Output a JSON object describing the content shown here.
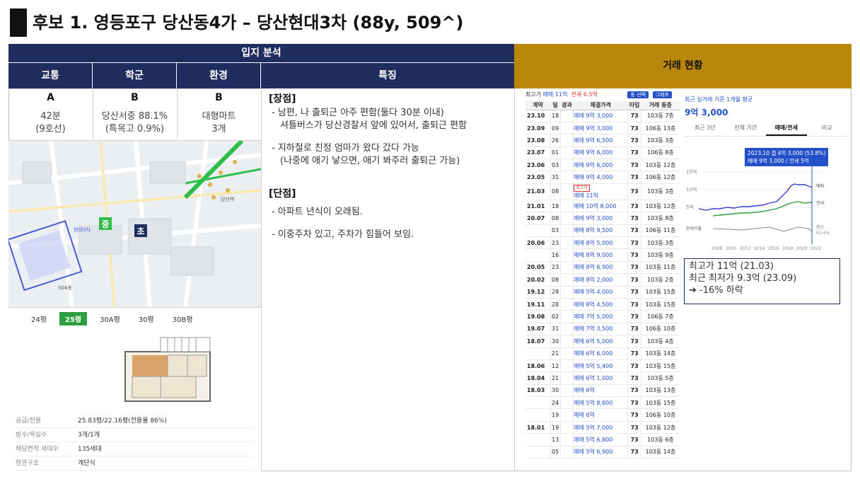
{
  "title": "후보 1. 영등포구 당산동4가 – 당산현대3차 (88y, 509^)",
  "analysis": {
    "header": "입지 분석",
    "columns": [
      "교통",
      "학군",
      "환경",
      "특징"
    ],
    "grades": [
      {
        "grade": "A",
        "desc_line1": "42분",
        "desc_line2": "(9호선)"
      },
      {
        "grade": "B",
        "desc_line1": "당산서중 88.1%",
        "desc_line2": "(특목고 0.9%)"
      },
      {
        "grade": "B",
        "desc_line1": "대형마트",
        "desc_line2": "3개"
      }
    ]
  },
  "map": {
    "labels": [
      "당산초",
      "중",
      "초",
      "현대3차",
      "당산역",
      "504동"
    ]
  },
  "floorplan": {
    "tabs": [
      "24평",
      "25평",
      "30A평",
      "30평",
      "30B평"
    ],
    "active_tab": "25평",
    "info": [
      {
        "k": "공급/전용",
        "v": "25.83평/22.16평(전용률 86%)"
      },
      {
        "k": "방수/욕실수",
        "v": "3개/1개"
      },
      {
        "k": "해당면적 세대수",
        "v": "135세대"
      },
      {
        "k": "현관구조",
        "v": "계단식"
      }
    ]
  },
  "features": {
    "pros_head": "[장점]",
    "pros": [
      "-  남편, 나 출퇴근 아주 편함(둘다 30분 이내)\n셔틀버스가 당산경찰서 앞에 있어서, 출퇴근 편함",
      "-  지하철로 친정 엄마가 왔다 갔다 가능\n(나중에 애기 낳으면, 애기 봐주러 출퇴근 가능)"
    ],
    "cons_head": "[단점]",
    "cons": [
      "-  아파트 년식이 오래됨.",
      "-  이중주차 있고, 주차가 힘들어 보임."
    ]
  },
  "deals": {
    "header": "거래 현황",
    "meta_high_label": "최고가",
    "meta_high_value": "매매 11억",
    "meta_rent_label": "전세 6.5억",
    "meta_btn1": "동 선택",
    "meta_btn2": "그래프",
    "table_headers": [
      "계약",
      "일",
      "경과",
      "체결가격",
      "타입",
      "거래 동층"
    ],
    "rows": [
      {
        "ym": "23.10",
        "d": "18",
        "price": "매매 9억 3,000",
        "type": "73",
        "floor": "103동 7층"
      },
      {
        "ym": "23.09",
        "d": "09",
        "price": "매매 9억 3,000",
        "type": "73",
        "floor": "106동 13층"
      },
      {
        "ym": "23.08",
        "d": "26",
        "price": "매매 9억 6,500",
        "type": "73",
        "floor": "103동 3층"
      },
      {
        "ym": "23.07",
        "d": "01",
        "price": "매매 9억 6,000",
        "type": "73",
        "floor": "106동 8층"
      },
      {
        "ym": "23.06",
        "d": "03",
        "price": "매매 9억 6,000",
        "type": "73",
        "floor": "103동 12층"
      },
      {
        "ym": "23.05",
        "d": "31",
        "price": "매매 9억 4,000",
        "type": "73",
        "floor": "106동 12층"
      },
      {
        "ym": "21.03",
        "d": "08",
        "price": "매매 11억",
        "type": "73",
        "floor": "103동 3층",
        "tag": "최고가"
      },
      {
        "ym": "21.01",
        "d": "18",
        "price": "매매 10억 8,000",
        "type": "73",
        "floor": "103동 12층"
      },
      {
        "ym": "20.07",
        "d": "08",
        "price": "매매 9억 3,000",
        "type": "73",
        "floor": "103동 8층"
      },
      {
        "ym": "",
        "d": "03",
        "price": "매매 8억 9,500",
        "type": "73",
        "floor": "106동 11층"
      },
      {
        "ym": "20.06",
        "d": "23",
        "price": "매매 8억 5,000",
        "type": "73",
        "floor": "103동 3층"
      },
      {
        "ym": "",
        "d": "16",
        "price": "매매 8억 9,000",
        "type": "73",
        "floor": "103동 9층"
      },
      {
        "ym": "20.05",
        "d": "23",
        "price": "매매 8억 6,900",
        "type": "73",
        "floor": "103동 11층"
      },
      {
        "ym": "20.02",
        "d": "08",
        "price": "매매 8억 2,000",
        "type": "73",
        "floor": "103동 2층"
      },
      {
        "ym": "19.12",
        "d": "28",
        "price": "매매 5억 4,000",
        "type": "73",
        "floor": "103동 15층"
      },
      {
        "ym": "19.11",
        "d": "28",
        "price": "매매 8억 4,500",
        "type": "73",
        "floor": "103동 15층"
      },
      {
        "ym": "19.08",
        "d": "02",
        "price": "매매 7억 5,000",
        "type": "73",
        "floor": "106동 7층"
      },
      {
        "ym": "19.07",
        "d": "31",
        "price": "매매 7억 3,500",
        "type": "73",
        "floor": "106동 10층"
      },
      {
        "ym": "18.07",
        "d": "30",
        "price": "매매 6억 5,000",
        "type": "73",
        "floor": "103동 4층"
      },
      {
        "ym": "",
        "d": "21",
        "price": "매매 6억 6,000",
        "type": "73",
        "floor": "103동 14층"
      },
      {
        "ym": "18.06",
        "d": "12",
        "price": "매매 5억 5,400",
        "type": "73",
        "floor": "103동 15층"
      },
      {
        "ym": "18.04",
        "d": "21",
        "price": "매매 6억 1,000",
        "type": "73",
        "floor": "103동 5층"
      },
      {
        "ym": "18.03",
        "d": "30",
        "price": "매매 6억",
        "type": "73",
        "floor": "103동 13층"
      },
      {
        "ym": "",
        "d": "24",
        "price": "매매 5억 8,800",
        "type": "73",
        "floor": "103동 15층"
      },
      {
        "ym": "",
        "d": "19",
        "price": "매매 6억",
        "type": "73",
        "floor": "106동 10층"
      },
      {
        "ym": "18.01",
        "d": "19",
        "price": "매매 5억 7,000",
        "type": "73",
        "floor": "103동 12층"
      },
      {
        "ym": "",
        "d": "13",
        "price": "매매 5억 6,800",
        "type": "73",
        "floor": "103동 6층"
      },
      {
        "ym": "",
        "d": "05",
        "price": "매매 5억 6,900",
        "type": "73",
        "floor": "103동 14층"
      }
    ],
    "chart": {
      "subtitle": "최근 실거래 기준 1개월 평균",
      "price": "9억 3,000",
      "tabs": [
        "최근 3년",
        "전체 기간",
        "매매/전세",
        "비교"
      ],
      "active_tab": "매매/전세",
      "tooltip_line1": "2023.10  갭 4억 3,000 (53.8%)",
      "tooltip_line2": "매매 9억 3,000 / 전세 5억",
      "y_ticks": [
        "15억",
        "10억",
        "5억"
      ],
      "x_ticks": [
        "2008",
        "2010",
        "2012",
        "2014",
        "2016",
        "2018",
        "2020",
        "2022"
      ],
      "legend_sale": "매매",
      "legend_rent": "전세",
      "ratio_label": "전세가율",
      "avg_label": "평균",
      "avg_value": "61.4%",
      "colors": {
        "sale": "#3a3ac8",
        "rent": "#2e9e3e",
        "ratio": "#888888"
      }
    },
    "summary_line1": "최고가 11억 (21.03)",
    "summary_line2": "최근 최저가 9.3억 (23.09)",
    "summary_line3": "➔  -16% 하락"
  }
}
